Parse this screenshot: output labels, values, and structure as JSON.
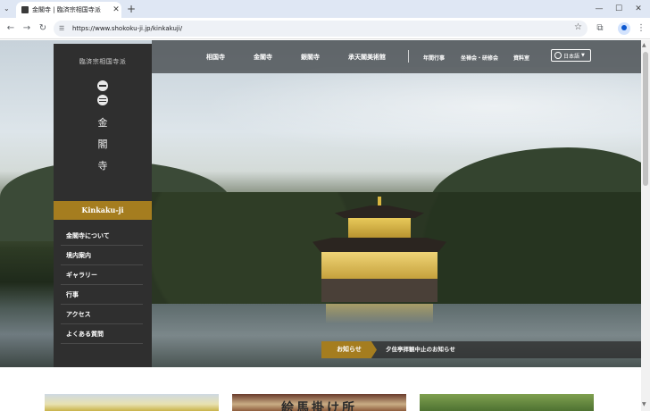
{
  "browser": {
    "tab_title": "金閣寺 | 臨済宗相国寺派",
    "tab_close": "✕",
    "new_tab": "+",
    "url": "https://www.shokoku-ji.jp/kinkakuji/",
    "icons": [
      "tab-list-icon",
      "favicon-icon",
      "back-icon",
      "forward-icon",
      "reload-icon",
      "site-info-icon",
      "star-icon",
      "extensions-icon",
      "profile-icon",
      "menu-icon",
      "minimize-icon",
      "maximize-icon",
      "close-window-icon"
    ]
  },
  "sidebar": {
    "subtitle": "臨済宗相国寺派",
    "title_chars": [
      "金",
      "閣",
      "寺"
    ],
    "brand": "Kinkaku-ji",
    "items": [
      {
        "label": "金閣寺について"
      },
      {
        "label": "境内案内"
      },
      {
        "label": "ギャラリー"
      },
      {
        "label": "行事"
      },
      {
        "label": "アクセス"
      },
      {
        "label": "よくある質問"
      }
    ]
  },
  "topnav": {
    "main_links": [
      "相国寺",
      "金閣寺",
      "銀閣寺",
      "承天閣美術館"
    ],
    "sub_links": [
      "年間行事",
      "坐禅会・研修会",
      "資料室"
    ],
    "language": "日本語"
  },
  "notice": {
    "label": "お知らせ",
    "text": "夕住亭拝観中止のお知らせ"
  },
  "cards": {
    "card2_text": "絵馬掛け所"
  },
  "colors": {
    "accent_gold": "#a57d1f",
    "sidebar_bg": "#2f2f2f",
    "chrome_tabbar": "#dfe7f4"
  }
}
